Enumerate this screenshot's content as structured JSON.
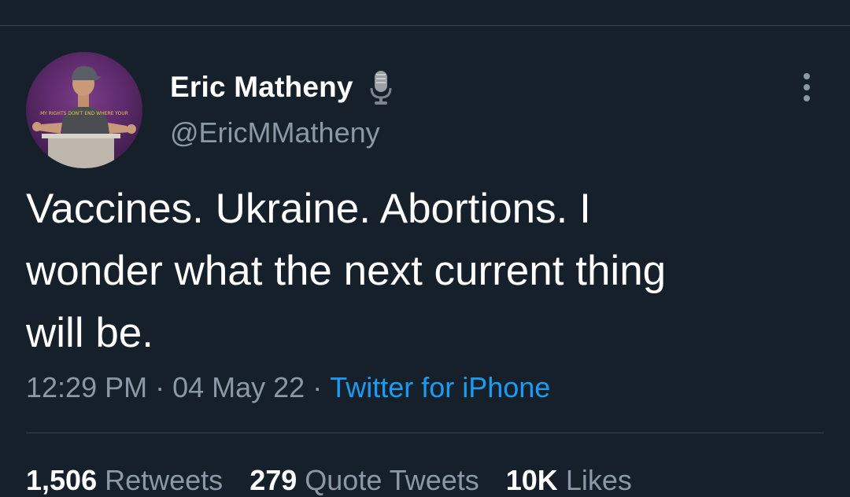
{
  "tweet": {
    "author": {
      "display_name": "Eric Matheny",
      "handle": "@EricMMatheny",
      "badge_icon": "microphone-icon",
      "avatar_shirt_text": "MY RIGHTS DON'T END WHERE YOUR"
    },
    "text_lines": [
      "Vaccines. Ukraine. Abortions. I",
      "wonder what the next current thing",
      "will be."
    ],
    "time": "12:29 PM",
    "separator": "·",
    "date": "04 May 22",
    "source": "Twitter for iPhone",
    "more_icon": "more-vertical-icon",
    "stats": {
      "retweets_count": "1,506",
      "retweets_label": "Retweets",
      "quotes_count": "279",
      "quotes_label": "Quote Tweets",
      "likes_count": "10K",
      "likes_label": "Likes"
    }
  },
  "colors": {
    "background": "#15202b",
    "divider": "#38444d",
    "secondary_text": "#8b98a5",
    "link": "#1d9bf0"
  }
}
